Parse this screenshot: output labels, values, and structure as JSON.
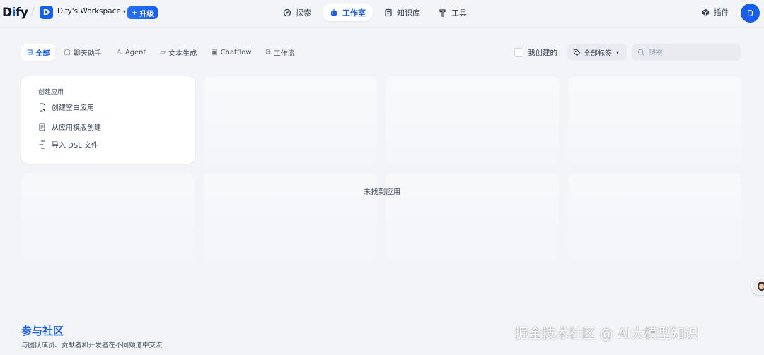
{
  "brand": {
    "logo_prefix": "D",
    "logo_i": "i",
    "logo_suffix": "fy"
  },
  "workspace": {
    "avatar_letter": "D",
    "name": "Dify's Workspace",
    "upgrade_label": "升级"
  },
  "nav": [
    {
      "label": "探索",
      "icon": "explore-icon"
    },
    {
      "label": "工作室",
      "icon": "robot-icon",
      "active": true
    },
    {
      "label": "知识库",
      "icon": "book-icon"
    },
    {
      "label": "工具",
      "icon": "hammer-icon"
    }
  ],
  "header_right": {
    "plugins_label": "插件",
    "user_letter": "D"
  },
  "filters": {
    "tabs": [
      {
        "label": "全部",
        "icon": "grid-icon",
        "active": true
      },
      {
        "label": "聊天助手",
        "icon": "chat-icon"
      },
      {
        "label": "Agent",
        "icon": "agent-icon"
      },
      {
        "label": "文本生成",
        "icon": "document-icon"
      },
      {
        "label": "Chatflow",
        "icon": "chatflow-icon"
      },
      {
        "label": "工作流",
        "icon": "workflow-icon"
      }
    ],
    "created_by_me_label": "我创建的",
    "tags_label": "全部标签",
    "search_placeholder": "搜索"
  },
  "create_card": {
    "title": "创建应用",
    "items": [
      {
        "label": "创建空白应用",
        "icon": "new-file-icon"
      },
      {
        "label": "从应用模版创建",
        "icon": "template-icon"
      },
      {
        "label": "导入 DSL 文件",
        "icon": "import-icon"
      }
    ]
  },
  "empty_state": "未找到应用",
  "footer": {
    "title": "参与社区",
    "subtitle": "与团队成员、贡献者和开发者在不同频道中交流"
  },
  "watermark": "掘金技术社区 @ AI大模型知识",
  "colors": {
    "accent": "#155eef",
    "background": "#f2f4f7",
    "text": "#344054"
  }
}
